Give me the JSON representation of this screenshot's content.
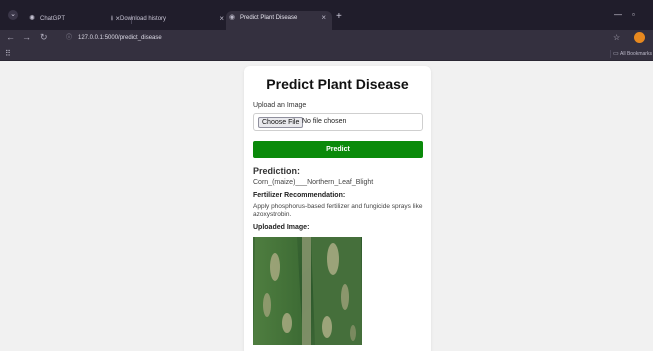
{
  "browser": {
    "tabs": [
      {
        "label": "ChatGPT",
        "icon": "chatgpt-icon"
      },
      {
        "label": "Download history",
        "icon": "download-icon"
      },
      {
        "label": "Predict Plant Disease",
        "icon": "globe-icon",
        "active": true
      }
    ],
    "url": "127.0.0.1:5000/predict_disease",
    "bookmarks_label": "All Bookmarks"
  },
  "page": {
    "title": "Predict Plant Disease",
    "upload_label": "Upload an Image",
    "choose_file_label": "Choose File",
    "no_file_text": "No file chosen",
    "predict_label": "Predict",
    "prediction_heading": "Prediction:",
    "prediction_value": "Corn_(maize)___Northern_Leaf_Blight",
    "fertilizer_heading": "Fertilizer Recommendation:",
    "fertilizer_value": "Apply phosphorus-based fertilizer and fungicide sprays like azoxystrobin.",
    "uploaded_heading": "Uploaded Image:"
  },
  "colors": {
    "predict_button": "#0a8a0a",
    "tab_bar": "#201d2b",
    "toolbar": "#34303f",
    "page_bg": "#f1f1f1"
  }
}
